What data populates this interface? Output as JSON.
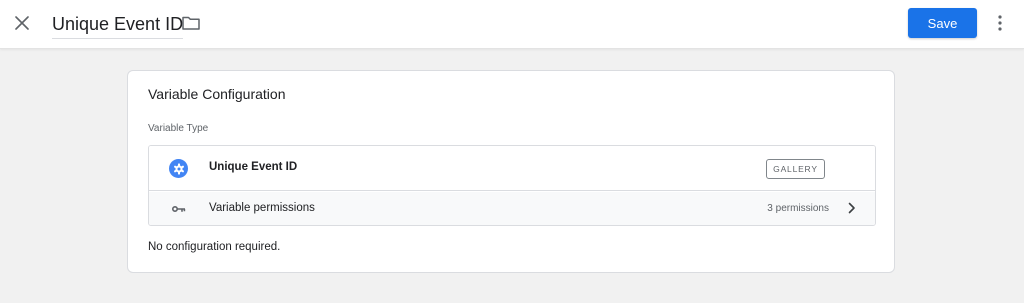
{
  "header": {
    "title": "Unique Event ID",
    "save_label": "Save",
    "icons": {
      "close": "close-icon",
      "folder": "folder-icon",
      "more": "more-vert-icon"
    }
  },
  "card": {
    "title": "Variable Configuration",
    "section_label": "Variable Type",
    "variable_type": {
      "name": "Unique Event ID",
      "badge": "GALLERY",
      "icon": "gear-icon"
    },
    "permissions": {
      "label": "Variable permissions",
      "count": "3 permissions",
      "icon": "key-icon",
      "chevron": "chevron-right-icon"
    },
    "note": "No configuration required."
  },
  "colors": {
    "accent": "#1a73e8",
    "type_icon": "#4285f4",
    "page_background": "#f1f1f1"
  }
}
